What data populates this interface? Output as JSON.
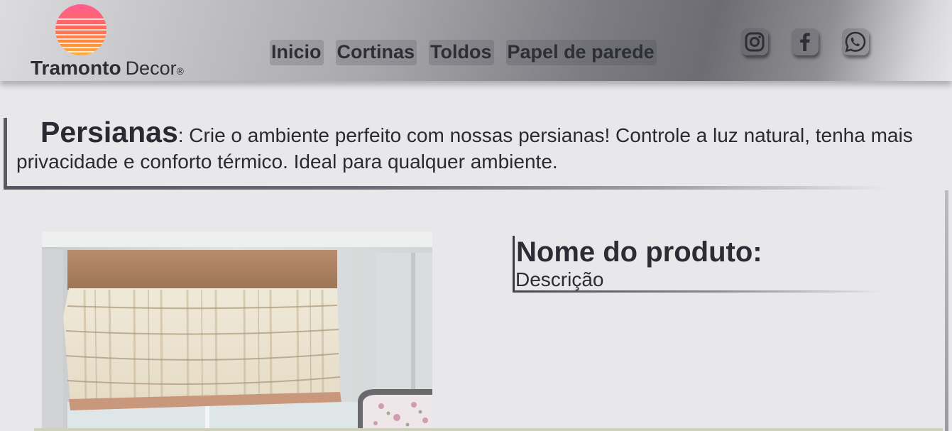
{
  "header": {
    "brand_name": "Tramonto",
    "brand_sub": "Decor",
    "brand_mark": "®",
    "logo_icon": "sunset-stripes-logo-icon",
    "nav": [
      {
        "label": "Inicio"
      },
      {
        "label": "Cortinas"
      },
      {
        "label": "Toldos"
      },
      {
        "label": "Papel de parede"
      }
    ],
    "social": [
      {
        "icon": "instagram-icon"
      },
      {
        "icon": "facebook-icon"
      },
      {
        "icon": "whatsapp-icon"
      }
    ]
  },
  "intro": {
    "title": "Persianas",
    "text": ": Crie o ambiente perfeito com nossas persianas! Controle a luz natural, tenha mais privacidade e conforto térmico. Ideal para qualquer ambiente."
  },
  "product": {
    "image": "roman-blind-photo",
    "name": "Nome do produto:",
    "description": "Descrição"
  },
  "colors": {
    "logo_gradient": [
      "#ff5d8f",
      "#ff8d3a",
      "#ffb03a"
    ],
    "text": "#2c2c34",
    "background": "#e8e8ea"
  }
}
